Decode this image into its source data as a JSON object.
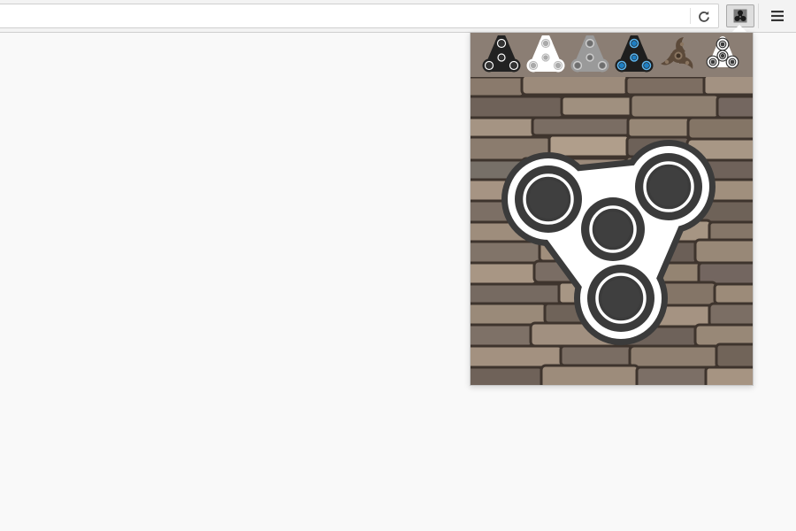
{
  "browser": {
    "url": {
      "value": "",
      "placeholder": ""
    },
    "icons": {
      "reload": "reload-icon",
      "extension": "fidget-spinner-icon",
      "menu": "hamburger-menu-icon"
    }
  },
  "popup": {
    "spinner_choices": [
      {
        "name": "black-spinner",
        "arm": "#222222",
        "bearing": "#333333",
        "ring": "#ffffff"
      },
      {
        "name": "white-spinner",
        "arm": "#ffffff",
        "bearing": "#aaaaaa",
        "ring": "#cccccc"
      },
      {
        "name": "gray-spinner",
        "arm": "#9a9a9a",
        "bearing": "#6e6e6e",
        "ring": "#cfcfcf"
      },
      {
        "name": "blue-black-spinner",
        "arm": "#1e1e1e",
        "bearing": "#1e7fc4",
        "ring": "#5bb4ee"
      },
      {
        "name": "brown-spinner",
        "arm": "#5c4a3a",
        "bearing": "#3f3226",
        "ring": "#8a7560"
      },
      {
        "name": "white-ring-spinner",
        "arm": "#ffffff",
        "bearing": "#3a3a3a",
        "ring": "#ffffff"
      }
    ],
    "selected": "white-ring-spinner",
    "background": "stone-wall",
    "colors": {
      "picker_bg": "#8b7e74",
      "stone_base": "#6b5c50"
    }
  }
}
